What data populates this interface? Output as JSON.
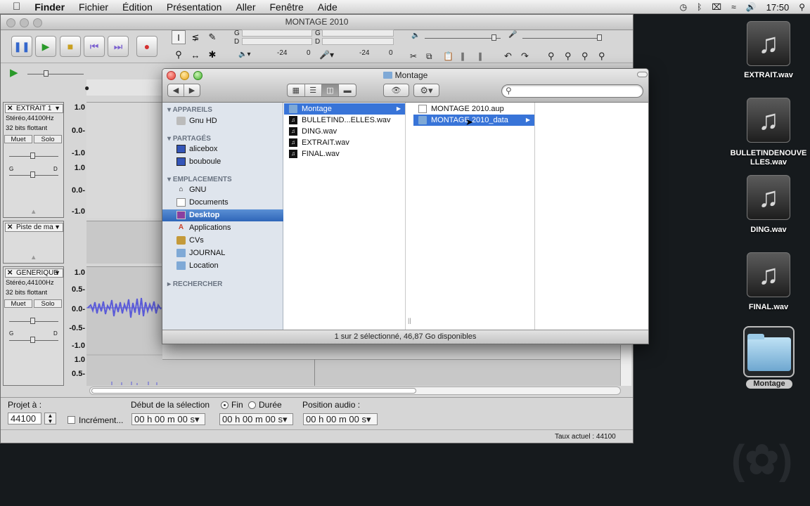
{
  "menubar": {
    "apple": "",
    "app": "Finder",
    "items": [
      "Fichier",
      "Édition",
      "Présentation",
      "Aller",
      "Fenêtre",
      "Aide"
    ],
    "clock": "17:50"
  },
  "audacity": {
    "title": "MONTAGE 2010",
    "meters": {
      "left_label": "G",
      "right_label": "D",
      "scale_a": "-24",
      "scale_b": "0"
    },
    "tracks": [
      {
        "name": "EXTRAIT 1",
        "info1": "Stéréo,44100Hz",
        "info2": "32 bits flottant",
        "mute": "Muet",
        "solo": "Solo",
        "g": "G",
        "d": "D",
        "scale": [
          "1.0",
          "0.0-",
          "-1.0",
          "1.0",
          "0.0-",
          "-1.0"
        ]
      },
      {
        "name": "Piste de ma"
      },
      {
        "name": "GENERIQUE",
        "info1": "Stéréo,44100Hz",
        "info2": "32 bits flottant",
        "mute": "Muet",
        "solo": "Solo",
        "g": "G",
        "d": "D",
        "scale": [
          "1.0",
          "0.5-",
          "0.0-",
          "-0.5-",
          "-1.0",
          "1.0",
          "0.5-"
        ]
      }
    ],
    "bottom": {
      "projet_label": "Projet à :",
      "rate": "44100",
      "increment_label": "Incrément...",
      "debut_label": "Début de la sélection",
      "fin_label": "Fin",
      "duree_label": "Durée",
      "position_label": "Position audio :",
      "time1": "00 h 00 m 00 s",
      "time2": "00 h 00 m 00 s",
      "time3": "00 h 00 m 00 s",
      "status": "Taux actuel : 44100"
    }
  },
  "finder": {
    "title": "Montage",
    "sidebar": {
      "sections": [
        "APPAREILS",
        "PARTAGÉS",
        "EMPLACEMENTS",
        "RECHERCHER"
      ],
      "appareils": [
        "Gnu HD"
      ],
      "partages": [
        "alicebox",
        "bouboule"
      ],
      "emplacements": [
        "GNU",
        "Documents",
        "Desktop",
        "Applications",
        "CVs",
        "JOURNAL",
        "Location"
      ]
    },
    "col1": [
      "Montage",
      "BULLETIND...ELLES.wav",
      "DING.wav",
      "EXTRAIT.wav",
      "FINAL.wav"
    ],
    "col2": [
      "MONTAGE 2010.aup",
      "MONTAGE 2010_data"
    ],
    "status": "1 sur 2 sélectionné, 46,87 Go disponibles"
  },
  "desktop": {
    "icons": [
      {
        "label": "EXTRAIT.wav",
        "icon": "music-note"
      },
      {
        "label": "BULLETINDENOUVELLES.wav",
        "icon": "music-note"
      },
      {
        "label": "DING.wav",
        "icon": "music-note"
      },
      {
        "label": "FINAL.wav",
        "icon": "music-note"
      },
      {
        "label": "Montage",
        "icon": "folder"
      }
    ]
  }
}
